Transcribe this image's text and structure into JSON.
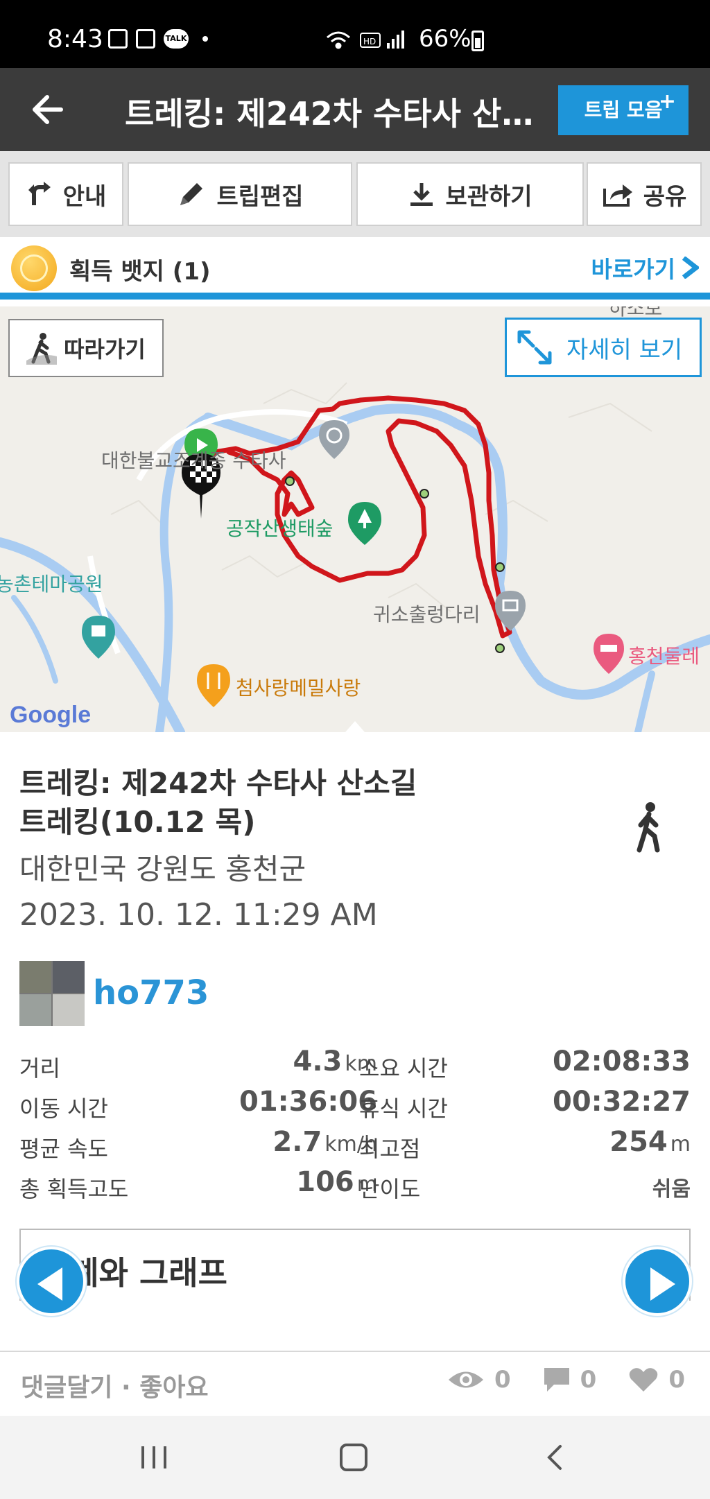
{
  "status_bar": {
    "time": "8:43",
    "talk_label": "TALK",
    "battery": "66%",
    "hd_label": "HD"
  },
  "app_bar": {
    "title": "트레킹: 제242차 수타사 산소길 트레킹(10.12 목)",
    "trip_collect_label": "트립 모음",
    "trip_collect_plus": "+"
  },
  "toolbar": {
    "guide": "안내",
    "edit": "트립편집",
    "save": "보관하기",
    "share": "공유"
  },
  "badge_bar": {
    "label": "획득 뱃지 (1)",
    "goto": "바로가기"
  },
  "map": {
    "follow": "따라가기",
    "detail_view": "자세히 보기",
    "places": {
      "temple": "대한불교조계종 수타사",
      "forest": "공작산생태숲",
      "theme_park": "농촌테마공원",
      "bridge": "귀소출렁다리",
      "restaurant": "첨사랑메밀사랑",
      "lodging": "홍천둘레",
      "top_right": "하소보"
    },
    "google": "Google",
    "colors": {
      "route": "#d0161b",
      "river": "#a9ccf2",
      "accent": "#1e95d9"
    }
  },
  "trip": {
    "title_line1": "트레킹: 제242차 수타사 산소길",
    "title_line2": "트레킹(10.12 목)",
    "location": "대한민국 강원도 홍천군",
    "datetime": "2023. 10. 12. 11:29 AM",
    "username": "ho773"
  },
  "stats": [
    {
      "label_l": "거리",
      "value_l": "4.3",
      "unit_l": "km",
      "label_r": "소요 시간",
      "value_r": "02:08:33",
      "unit_r": ""
    },
    {
      "label_l": "이동 시간",
      "value_l": "01:36:06",
      "unit_l": "",
      "label_r": "휴식 시간",
      "value_r": "00:32:27",
      "unit_r": ""
    },
    {
      "label_l": "평균 속도",
      "value_l": "2.7",
      "unit_l": "km/h",
      "label_r": "최고점",
      "value_r": "254",
      "unit_r": "m"
    },
    {
      "label_l": "총 획득고도",
      "value_l": "106",
      "unit_l": "m",
      "label_r": "난이도",
      "value_r": "쉬움",
      "unit_r": ""
    }
  ],
  "stats_graph": {
    "label": "통계와 그래프",
    "chevron": "›"
  },
  "footer": {
    "comment_like": "댓글달기 · 좋아요",
    "views": "0",
    "comments": "0",
    "likes": "0"
  }
}
